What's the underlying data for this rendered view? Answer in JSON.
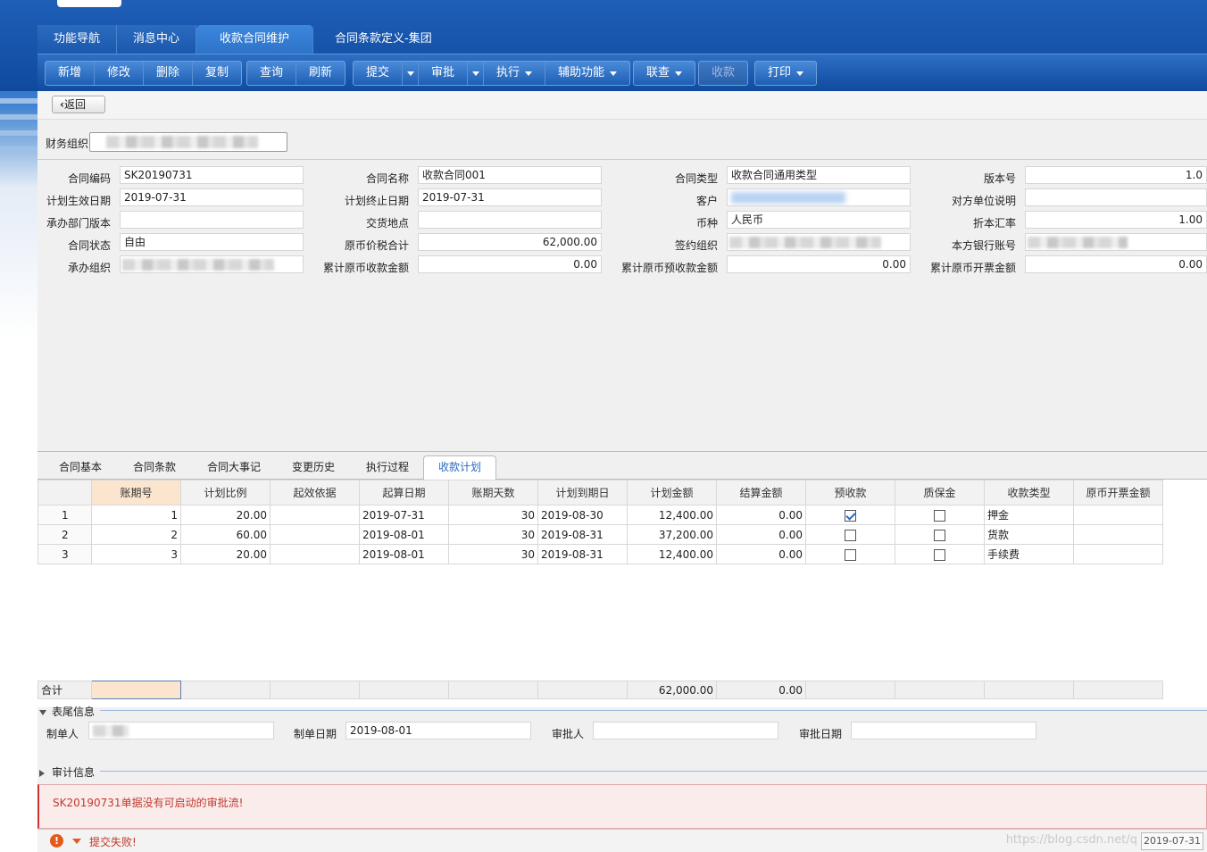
{
  "tabs": [
    {
      "label": "功能导航",
      "active": false
    },
    {
      "label": "消息中心",
      "active": false
    },
    {
      "label": "收款合同维护",
      "active": true
    },
    {
      "label": "合同条款定义-集团",
      "active": false
    }
  ],
  "toolbar": {
    "add": "新增",
    "edit": "修改",
    "delete": "删除",
    "copy": "复制",
    "query": "查询",
    "refresh": "刷新",
    "submit": "提交",
    "approve": "审批",
    "execute": "执行",
    "assist": "辅助功能",
    "linkquery": "联查",
    "receive": "收款",
    "print": "打印"
  },
  "back_label": "返回",
  "org": {
    "label": "财务组织(0"
  },
  "form": {
    "contract_code": {
      "label": "合同编码",
      "value": "SK20190731"
    },
    "plan_start": {
      "label": "计划生效日期",
      "value": "2019-07-31"
    },
    "dept_version": {
      "label": "承办部门版本",
      "value": ""
    },
    "status": {
      "label": "合同状态",
      "value": "自由"
    },
    "org": {
      "label": "承办组织",
      "value": ""
    },
    "contract_name": {
      "label": "合同名称",
      "value": "收款合同001"
    },
    "plan_end": {
      "label": "计划终止日期",
      "value": "2019-07-31"
    },
    "delivery": {
      "label": "交货地点",
      "value": ""
    },
    "orig_tax_total": {
      "label": "原币价税合计",
      "value": "62,000.00"
    },
    "orig_received": {
      "label": "累计原币收款金额",
      "value": "0.00"
    },
    "contract_type": {
      "label": "合同类型",
      "value": "收款合同通用类型"
    },
    "customer": {
      "label": "客户",
      "value": ""
    },
    "currency": {
      "label": "币种",
      "value": "人民币"
    },
    "sign_org": {
      "label": "签约组织",
      "value": ""
    },
    "orig_prereceived": {
      "label": "累计原币预收款金额",
      "value": "0.00"
    },
    "version": {
      "label": "版本号",
      "value": "1.0"
    },
    "counterparty_desc": {
      "label": "对方单位说明",
      "value": ""
    },
    "exchange_rate": {
      "label": "折本汇率",
      "value": "1.00"
    },
    "bank_account": {
      "label": "本方银行账号",
      "value": ""
    },
    "orig_invoiced": {
      "label": "累计原币开票金额",
      "value": "0.00"
    }
  },
  "bodytabs": [
    {
      "label": "合同基本",
      "active": false
    },
    {
      "label": "合同条款",
      "active": false
    },
    {
      "label": "合同大事记",
      "active": false
    },
    {
      "label": "变更历史",
      "active": false
    },
    {
      "label": "执行过程",
      "active": false
    },
    {
      "label": "收款计划",
      "active": true
    }
  ],
  "grid": {
    "columns": [
      "",
      "账期号",
      "计划比例",
      "起效依据",
      "起算日期",
      "账期天数",
      "计划到期日",
      "计划金额",
      "结算金额",
      "预收款",
      "质保金",
      "收款类型",
      "原币开票金额"
    ],
    "rows": [
      {
        "idx": "1",
        "period": "1",
        "ratio": "20.00",
        "basis": "",
        "start": "2019-07-31",
        "days": "30",
        "due": "2019-08-30",
        "amount": "12,400.00",
        "settled": "0.00",
        "prepay": true,
        "warranty": false,
        "type": "押金",
        "invoiced": ""
      },
      {
        "idx": "2",
        "period": "2",
        "ratio": "60.00",
        "basis": "",
        "start": "2019-08-01",
        "days": "30",
        "due": "2019-08-31",
        "amount": "37,200.00",
        "settled": "0.00",
        "prepay": false,
        "warranty": false,
        "type": "货款",
        "invoiced": ""
      },
      {
        "idx": "3",
        "period": "3",
        "ratio": "20.00",
        "basis": "",
        "start": "2019-08-01",
        "days": "30",
        "due": "2019-08-31",
        "amount": "12,400.00",
        "settled": "0.00",
        "prepay": false,
        "warranty": false,
        "type": "手续费",
        "invoiced": ""
      }
    ],
    "total": {
      "label": "合计",
      "amount": "62,000.00",
      "settled": "0.00"
    }
  },
  "tail": {
    "section": "表尾信息",
    "creator": {
      "label": "制单人",
      "value": ""
    },
    "create_date": {
      "label": "制单日期",
      "value": "2019-08-01"
    },
    "approver": {
      "label": "审批人",
      "value": ""
    },
    "approve_date": {
      "label": "审批日期",
      "value": ""
    }
  },
  "audit_section": "审计信息",
  "error_message": "SK20190731单据没有可启动的审批流!",
  "status": {
    "text": "提交失败!",
    "date": "2019-07-31",
    "watermark": "https://blog.csdn.net/q"
  },
  "colors": {
    "primary": "#1f5fb8",
    "active_tab": "#2d73c9",
    "error": "#c0392b",
    "error_bg": "#fbecec"
  }
}
